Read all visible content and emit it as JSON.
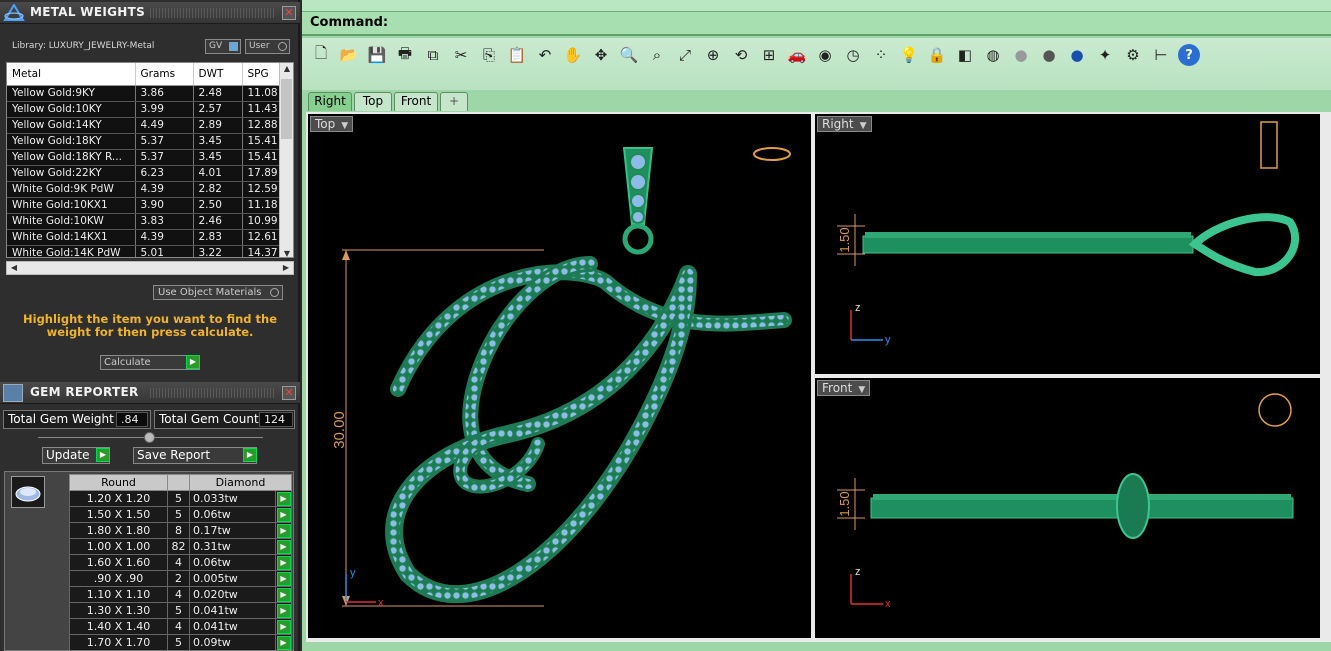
{
  "metal_panel": {
    "title": "METAL WEIGHTS",
    "library": "Library: LUXURY_JEWELRY-Metal",
    "gv_label": "GV",
    "user_label": "User",
    "columns": [
      "Metal",
      "Grams",
      "DWT",
      "SPG"
    ],
    "rows": [
      [
        "Yellow Gold:9KY",
        "3.86",
        "2.48",
        "11.08"
      ],
      [
        "Yellow Gold:10KY",
        "3.99",
        "2.57",
        "11.43"
      ],
      [
        "Yellow Gold:14KY",
        "4.49",
        "2.89",
        "12.88"
      ],
      [
        "Yellow Gold:18KY",
        "5.37",
        "3.45",
        "15.41"
      ],
      [
        "Yellow Gold:18KY R...",
        "5.37",
        "3.45",
        "15.41"
      ],
      [
        "Yellow Gold:22KY",
        "6.23",
        "4.01",
        "17.89"
      ],
      [
        "White Gold:9K PdW",
        "4.39",
        "2.82",
        "12.59"
      ],
      [
        "White Gold:10KX1",
        "3.90",
        "2.50",
        "11.18"
      ],
      [
        "White Gold:10KW",
        "3.83",
        "2.46",
        "10.99"
      ],
      [
        "White Gold:14KX1",
        "4.39",
        "2.83",
        "12.61"
      ],
      [
        "White Gold:14K PdW",
        "5.01",
        "3.22",
        "14.37"
      ]
    ],
    "use_object_materials": "Use Object Materials",
    "hint": "Highlight the item you want to find the weight for then press calculate.",
    "calculate": "Calculate"
  },
  "gem_panel": {
    "title": "GEM REPORTER",
    "total_weight_label": "Total Gem Weight",
    "total_weight": ".84",
    "total_count_label": "Total Gem Count",
    "total_count": "124",
    "update": "Update",
    "save_report": "Save Report",
    "columns": [
      "Round",
      "",
      "Diamond"
    ],
    "rows": [
      [
        "1.20 X 1.20",
        "5",
        "0.033tw"
      ],
      [
        "1.50 X 1.50",
        "5",
        "0.06tw"
      ],
      [
        "1.80 X 1.80",
        "8",
        "0.17tw"
      ],
      [
        "1.00 X 1.00",
        "82",
        "0.31tw"
      ],
      [
        "1.60 X 1.60",
        "4",
        "0.06tw"
      ],
      [
        ".90 X .90",
        "2",
        "0.005tw"
      ],
      [
        "1.10 X 1.10",
        "4",
        "0.020tw"
      ],
      [
        "1.30 X 1.30",
        "5",
        "0.041tw"
      ],
      [
        "1.40 X 1.40",
        "4",
        "0.041tw"
      ],
      [
        "1.70 X 1.70",
        "5",
        "0.09tw"
      ]
    ]
  },
  "command": {
    "label": "Command:"
  },
  "toolbar_icons": [
    "new-icon",
    "open-icon",
    "save-icon",
    "print-icon",
    "import-icon",
    "cut-icon",
    "copy-icon",
    "paste-icon",
    "undo-icon",
    "pan-icon",
    "move-icon",
    "zoom-in-icon",
    "zoom-window-icon",
    "zoom-extents-icon",
    "zoom-selected-icon",
    "rotate-view-icon",
    "four-viewports-icon",
    "car-icon",
    "eye-icon",
    "clock-icon",
    "points-icon",
    "lightbulb-icon",
    "lock-icon",
    "layers-icon",
    "color-wheel-icon",
    "sphere-grey-icon",
    "sphere-dark-icon",
    "sphere-blue-icon",
    "render-icon",
    "settings-gear-icon",
    "dimension-icon",
    "help-icon"
  ],
  "tabs": [
    "Right",
    "Top",
    "Front",
    "+"
  ],
  "viewports": {
    "top": {
      "label": "Top",
      "dimension": "30.00"
    },
    "right": {
      "label": "Right",
      "dimension": "1.50"
    },
    "front": {
      "label": "Front",
      "dimension": "1.50"
    }
  },
  "axes": {
    "x": "x",
    "y": "y",
    "z": "z"
  },
  "colors": {
    "model_green": "#2aa876",
    "stone_blue": "#7fb4e6",
    "dimension_orange": "#e0a060",
    "ui_green": "#9fd6a8"
  }
}
